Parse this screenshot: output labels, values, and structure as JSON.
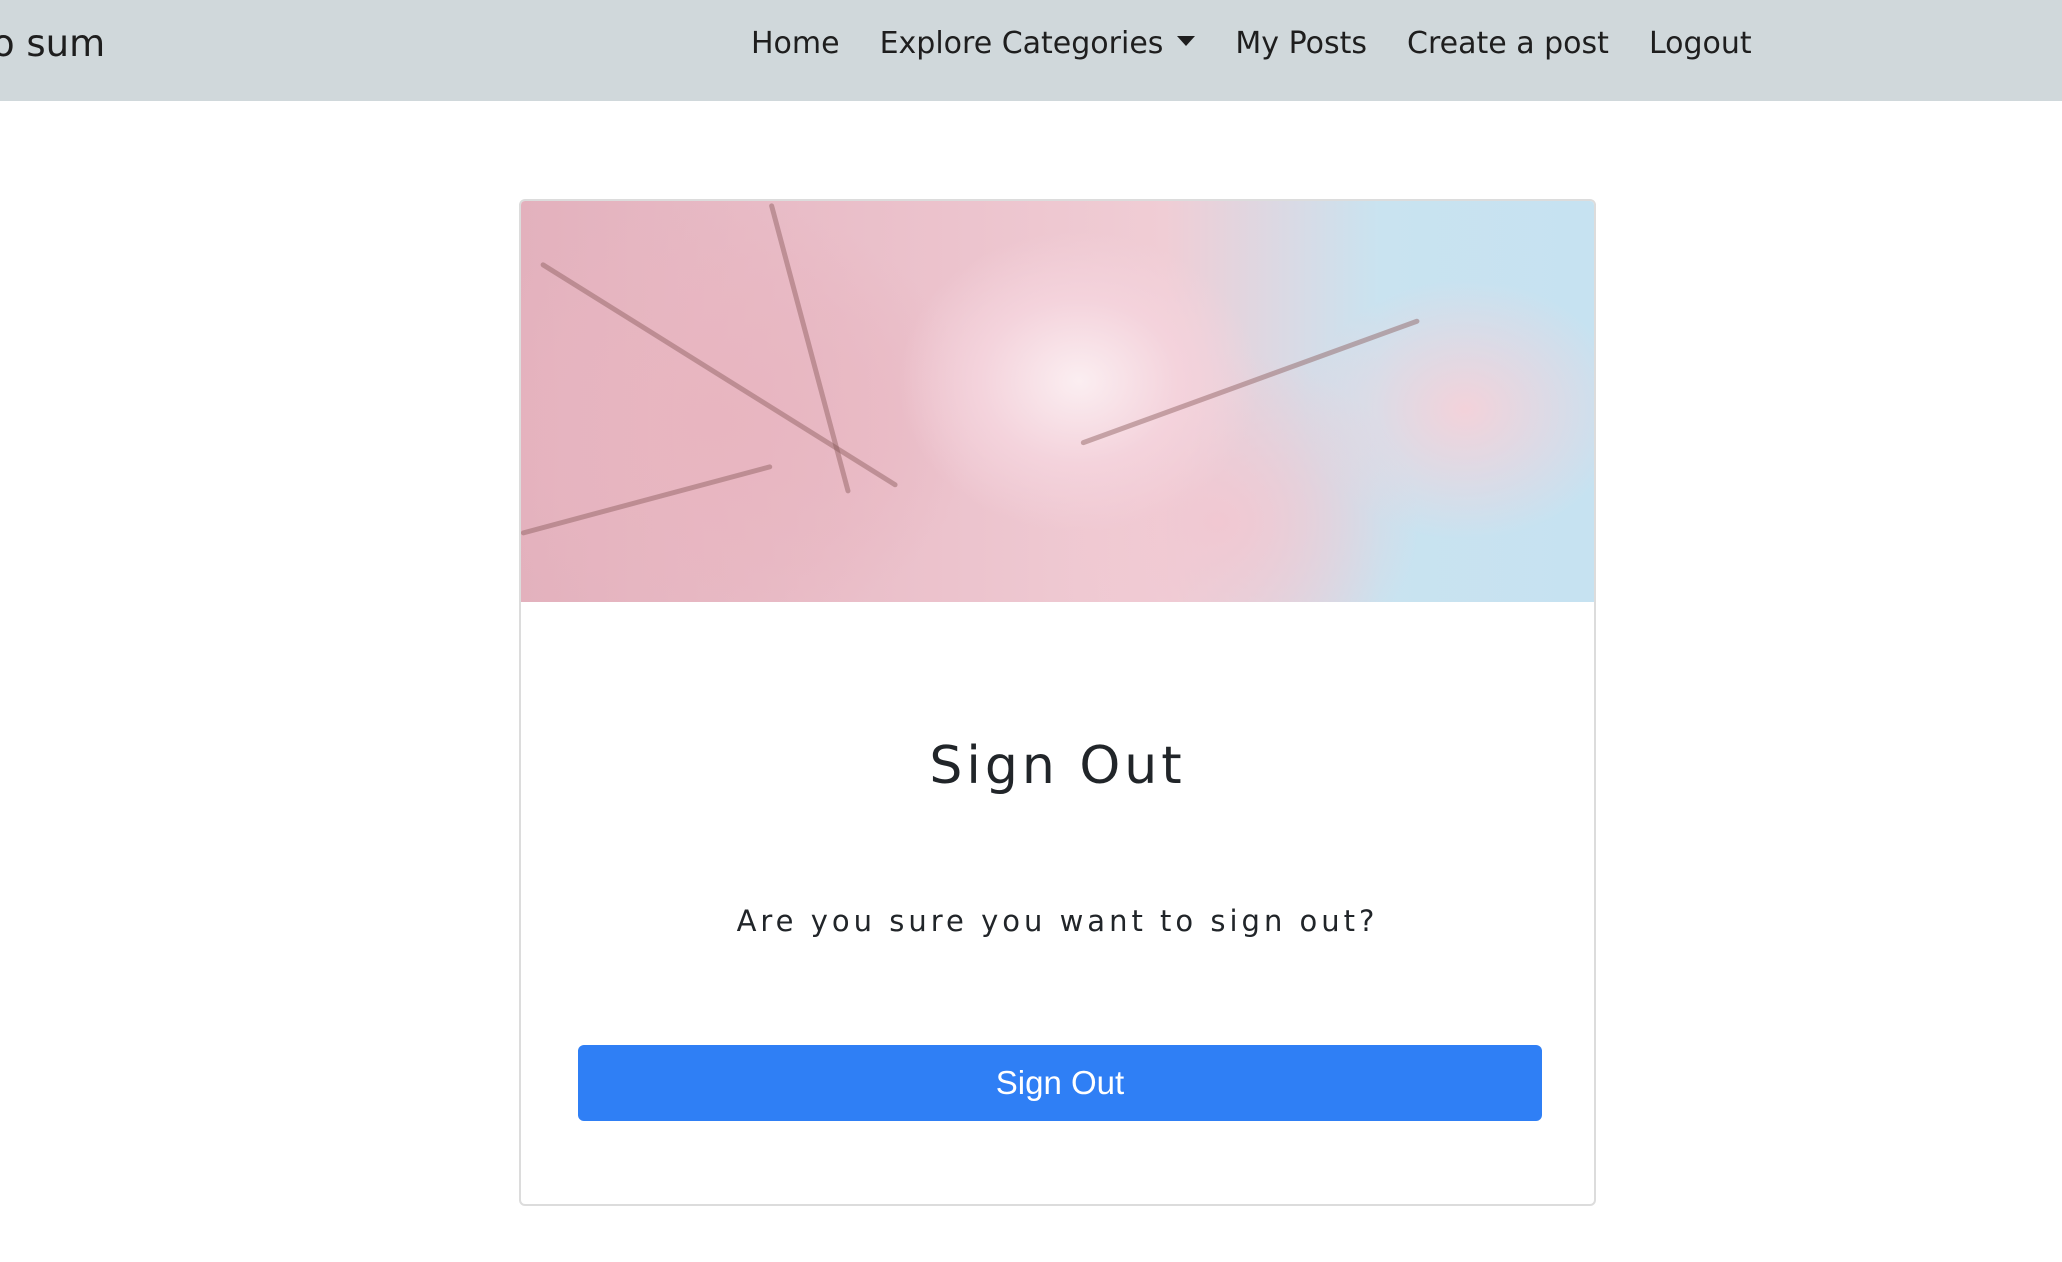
{
  "navbar": {
    "brand": "o sum",
    "items": [
      {
        "label": "Home"
      },
      {
        "label": "Explore Categories"
      },
      {
        "label": "My Posts"
      },
      {
        "label": "Create a post"
      },
      {
        "label": "Logout"
      }
    ]
  },
  "card": {
    "title": "Sign Out",
    "message": "Are you sure you want to sign out?",
    "button_label": "Sign Out"
  },
  "colors": {
    "navbar_bg": "#d0d8db",
    "button_bg": "#2f7ff5"
  }
}
